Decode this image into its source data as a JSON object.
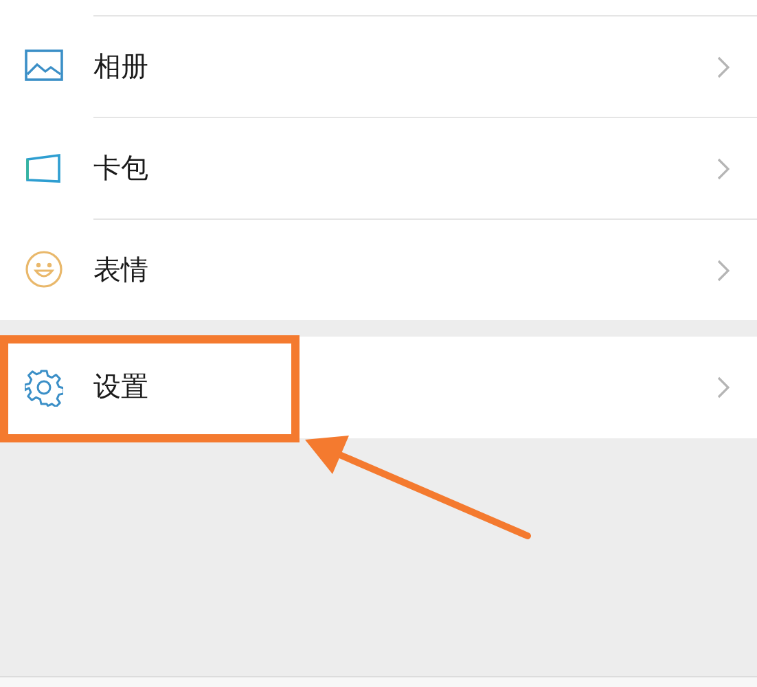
{
  "groups": [
    {
      "items": [
        {
          "kind": "album",
          "label": "相册",
          "highlighted": false
        },
        {
          "kind": "cards",
          "label": "卡包",
          "highlighted": false
        },
        {
          "kind": "stickers",
          "label": "表情",
          "highlighted": false
        }
      ]
    },
    {
      "items": [
        {
          "kind": "settings",
          "label": "设置",
          "highlighted": true
        }
      ]
    }
  ]
}
